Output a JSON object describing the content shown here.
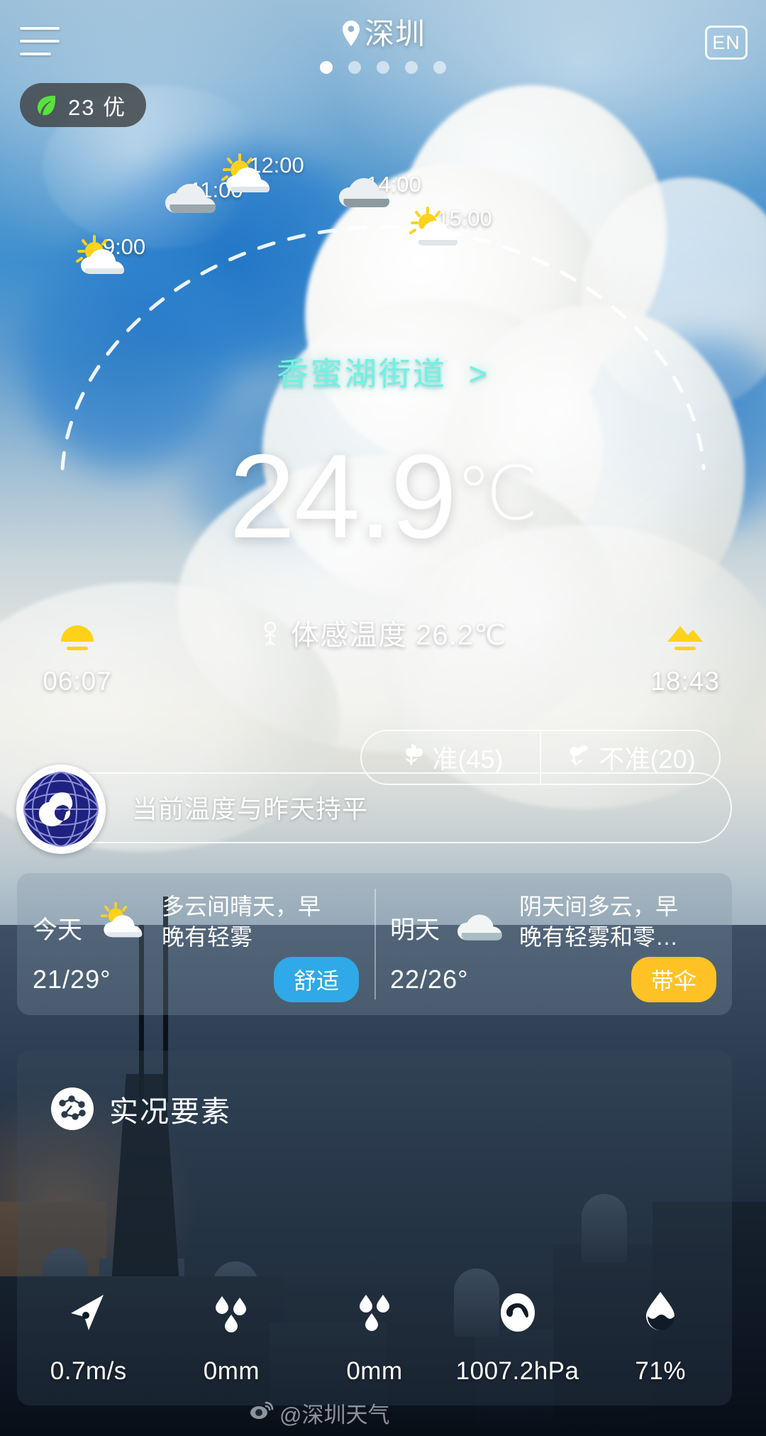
{
  "header": {
    "city": "深圳",
    "location_icon": "map-pin-icon",
    "menu_icon": "hamburger-menu-icon",
    "language_button": "EN",
    "page_dots": 5,
    "active_dot": 0
  },
  "air_quality": {
    "icon": "leaf-icon",
    "value": "23",
    "level": "优"
  },
  "hourly": [
    {
      "time": "9:00",
      "icon": "sun-cloud-icon"
    },
    {
      "time": "11:00",
      "icon": "cloud-icon"
    },
    {
      "time": "12:00",
      "icon": "sun-cloud-icon"
    },
    {
      "time": "14:00",
      "icon": "cloud-icon"
    },
    {
      "time": "15:00",
      "icon": "sun-cloud-icon"
    }
  ],
  "sub_location": {
    "name": "香蜜湖街道",
    "chevron": "›"
  },
  "current": {
    "temperature": "24.9",
    "unit": "℃",
    "feels_like_label": "体感温度",
    "feels_like_value": "26.2℃",
    "feels_like_icon": "person-icon"
  },
  "sun": {
    "sunrise_icon": "sunrise-icon",
    "sunrise": "06:07",
    "sunset_icon": "sunset-icon",
    "sunset": "18:43"
  },
  "rating": {
    "accurate_icon": "flower-bloom-icon",
    "accurate_label": "准(45)",
    "inaccurate_icon": "flower-wilt-icon",
    "inaccurate_label": "不准(20)"
  },
  "compare_banner": {
    "logo_icon": "cma-globe-logo-icon",
    "text": "当前温度与昨天持平"
  },
  "forecast": [
    {
      "day_label": "今天",
      "icon": "sun-cloud-icon",
      "description": "多云间晴天，早晚有轻雾",
      "range": "21/29°",
      "badge": "舒适",
      "badge_color": "#2fa9e8"
    },
    {
      "day_label": "明天",
      "icon": "cloud-icon",
      "description": "阴天间多云，早晚有轻雾和零…",
      "range": "22/26°",
      "badge": "带伞",
      "badge_color": "#ffc224"
    }
  ],
  "live_elements": {
    "icon": "circuit-node-icon",
    "title": "实况要素",
    "metrics": [
      {
        "icon": "wind-direction-arrow-icon",
        "value": "0.7m/s"
      },
      {
        "icon": "rain-drops-icon",
        "value": "0mm"
      },
      {
        "icon": "rain-drops-two-icon",
        "value": "0mm"
      },
      {
        "icon": "pressure-gauge-icon",
        "value": "1007.2hPa"
      },
      {
        "icon": "humidity-drop-icon",
        "value": "71%"
      }
    ]
  },
  "watermark": {
    "icon": "weibo-icon",
    "text": "@深圳天气"
  }
}
